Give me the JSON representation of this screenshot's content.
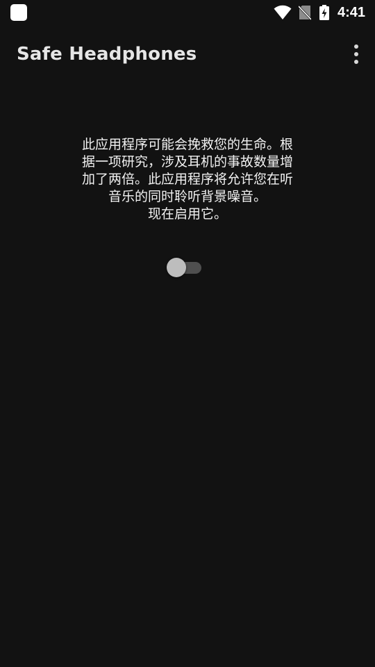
{
  "status_bar": {
    "time": "4:41",
    "icons": [
      "app-notification-icon",
      "wifi-icon",
      "no-sim-icon",
      "battery-charging-icon"
    ]
  },
  "app_bar": {
    "title": "Safe Headphones",
    "menu_icon": "more-vert-icon"
  },
  "main": {
    "description": "此应用程序可能会挽救您的生命。根\n据一项研究，涉及耳机的事故数量增\n加了两倍。此应用程序将允许您在听\n音乐的同时聆听背景噪音。\n现在启用它。",
    "toggle": {
      "checked": false
    }
  },
  "colors": {
    "background": "#121212",
    "text": "#f2f2f2",
    "title": "#e6e6e6",
    "toggle_track": "#4f4f4f",
    "toggle_thumb": "#bdbdbd"
  }
}
